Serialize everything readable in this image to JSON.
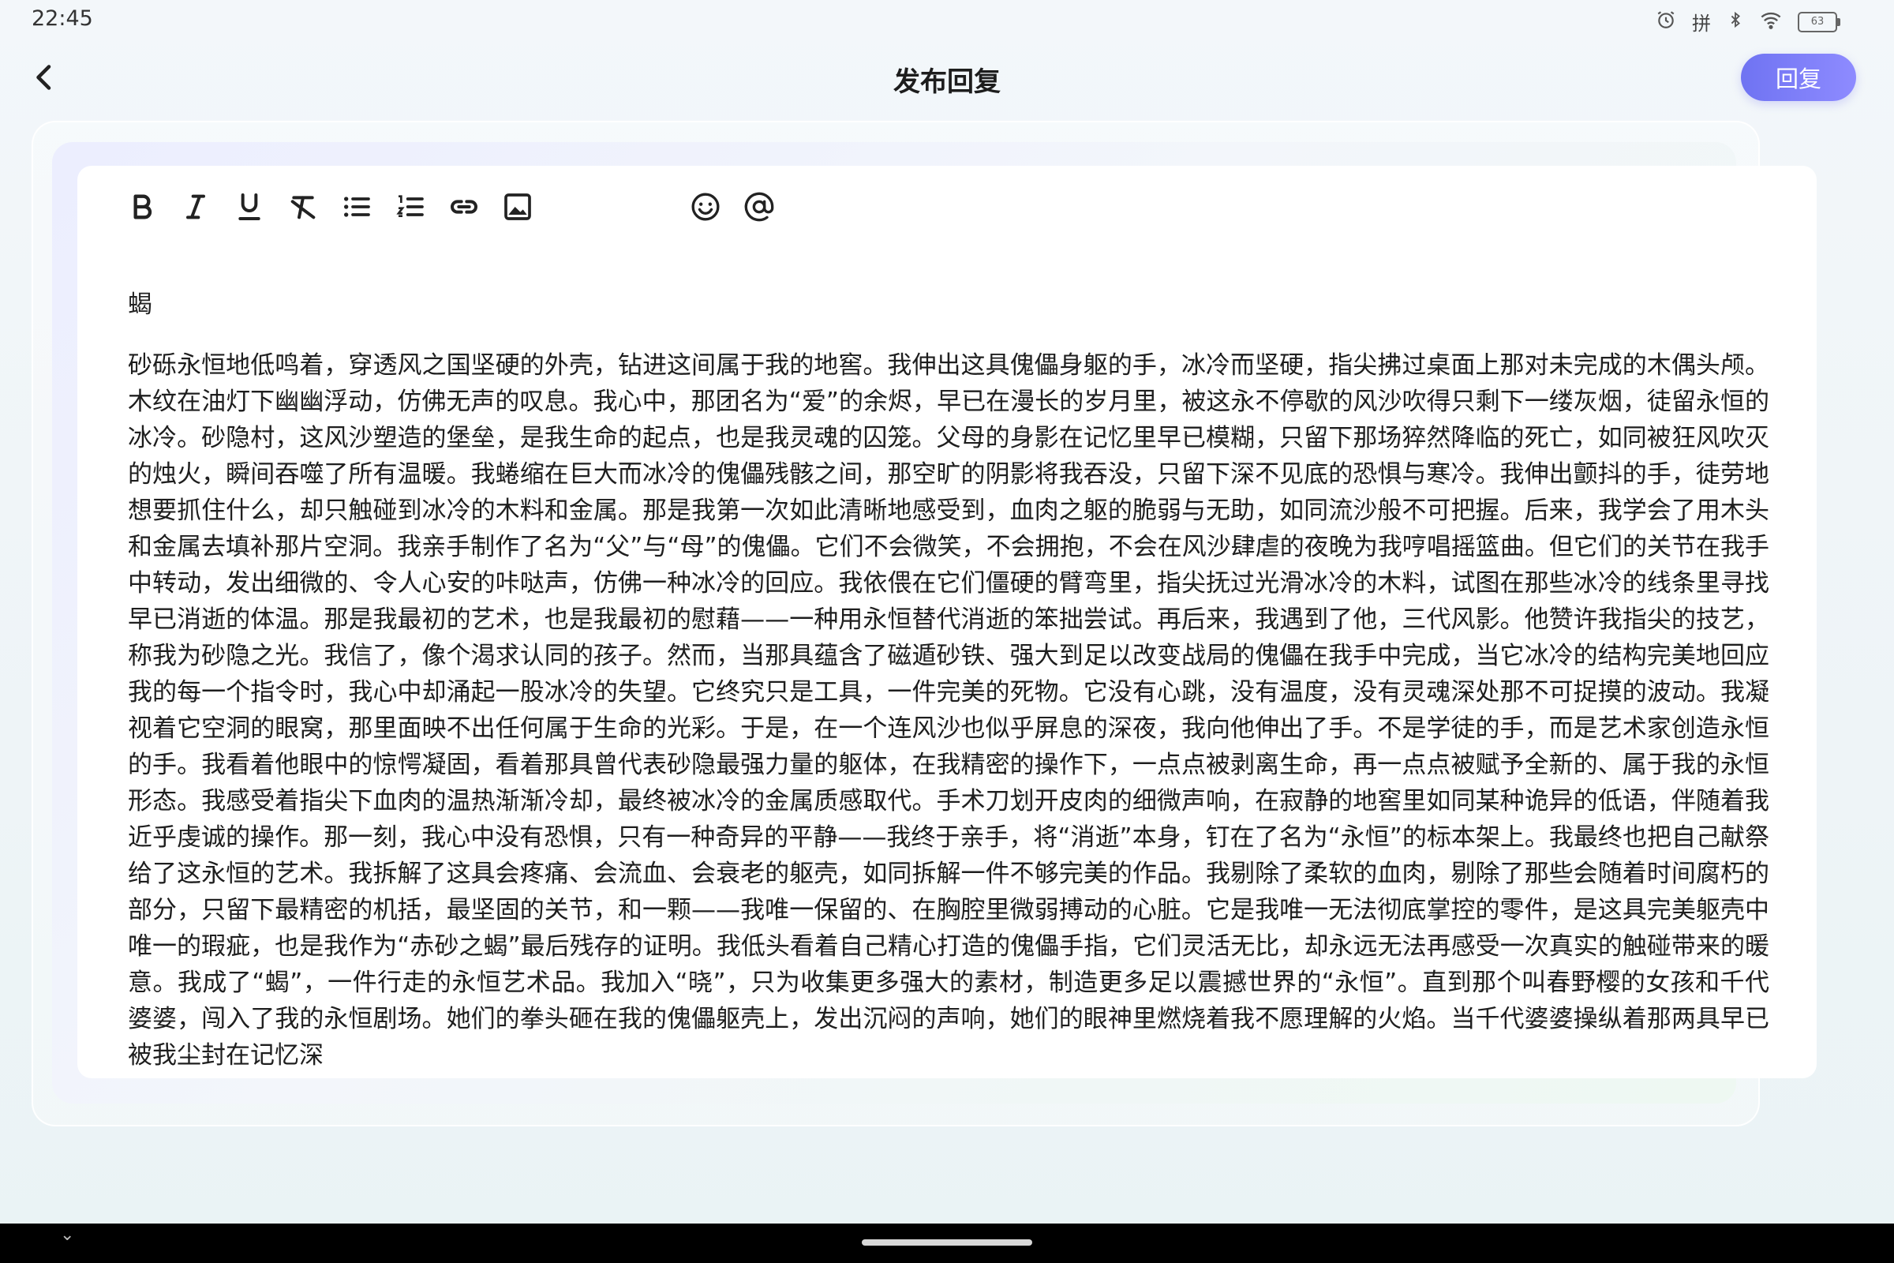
{
  "status": {
    "time": "22:45",
    "ime": "拼",
    "battery": "63"
  },
  "header": {
    "title": "发布回复",
    "reply_label": "回复"
  },
  "toolbar": {
    "tools": [
      "bold-icon",
      "italic-icon",
      "underline-icon",
      "clear-format-icon",
      "bullet-list-icon",
      "numbered-list-icon",
      "link-icon",
      "image-icon",
      "emoji-icon",
      "mention-icon"
    ]
  },
  "post": {
    "title": "蝎",
    "body": "砂砾永恒地低鸣着，穿透风之国坚硬的外壳，钻进这间属于我的地窖。我伸出这具傀儡身躯的手，冰冷而坚硬，指尖拂过桌面上那对未完成的木偶头颅。木纹在油灯下幽幽浮动，仿佛无声的叹息。我心中，那团名为“爱”的余烬，早已在漫长的岁月里，被这永不停歇的风沙吹得只剩下一缕灰烟，徒留永恒的冰冷。砂隐村，这风沙塑造的堡垒，是我生命的起点，也是我灵魂的囚笼。父母的身影在记忆里早已模糊，只留下那场猝然降临的死亡，如同被狂风吹灭的烛火，瞬间吞噬了所有温暖。我蜷缩在巨大而冰冷的傀儡残骸之间，那空旷的阴影将我吞没，只留下深不见底的恐惧与寒冷。我伸出颤抖的手，徒劳地想要抓住什么，却只触碰到冰冷的木料和金属。那是我第一次如此清晰地感受到，血肉之躯的脆弱与无助，如同流沙般不可把握。后来，我学会了用木头和金属去填补那片空洞。我亲手制作了名为“父”与“母”的傀儡。它们不会微笑，不会拥抱，不会在风沙肆虐的夜晚为我哼唱摇篮曲。但它们的关节在我手中转动，发出细微的、令人心安的咔哒声，仿佛一种冰冷的回应。我依偎在它们僵硬的臂弯里，指尖抚过光滑冰冷的木料，试图在那些冰冷的线条里寻找早已消逝的体温。那是我最初的艺术，也是我最初的慰藉——一种用永恒替代消逝的笨拙尝试。再后来，我遇到了他，三代风影。他赞许我指尖的技艺，称我为砂隐之光。我信了，像个渴求认同的孩子。然而，当那具蕴含了磁遁砂铁、强大到足以改变战局的傀儡在我手中完成，当它冰冷的结构完美地回应我的每一个指令时，我心中却涌起一股冰冷的失望。它终究只是工具，一件完美的死物。它没有心跳，没有温度，没有灵魂深处那不可捉摸的波动。我凝视着它空洞的眼窝，那里面映不出任何属于生命的光彩。于是，在一个连风沙也似乎屏息的深夜，我向他伸出了手。不是学徒的手，而是艺术家创造永恒的手。我看着他眼中的惊愕凝固，看着那具曾代表砂隐最强力量的躯体，在我精密的操作下，一点点被剥离生命，再一点点被赋予全新的、属于我的永恒形态。我感受着指尖下血肉的温热渐渐冷却，最终被冰冷的金属质感取代。手术刀划开皮肉的细微声响，在寂静的地窖里如同某种诡异的低语，伴随着我近乎虔诚的操作。那一刻，我心中没有恐惧，只有一种奇异的平静——我终于亲手，将“消逝”本身，钉在了名为“永恒”的标本架上。我最终也把自己献祭给了这永恒的艺术。我拆解了这具会疼痛、会流血、会衰老的躯壳，如同拆解一件不够完美的作品。我剔除了柔软的血肉，剔除了那些会随着时间腐朽的部分，只留下最精密的机括，最坚固的关节，和一颗——我唯一保留的、在胸腔里微弱搏动的心脏。它是我唯一无法彻底掌控的零件，是这具完美躯壳中唯一的瑕疵，也是我作为“赤砂之蝎”最后残存的证明。我低头看着自己精心打造的傀儡手指，它们灵活无比，却永远无法再感受一次真实的触碰带来的暖意。我成了“蝎”，一件行走的永恒艺术品。我加入“晓”，只为收集更多强大的素材，制造更多足以震撼世界的“永恒”。直到那个叫春野樱的女孩和千代婆婆，闯入了我的永恒剧场。她们的拳头砸在我的傀儡躯壳上，发出沉闷的声响，她们的眼神里燃烧着我不愿理解的火焰。当千代婆婆操纵着那两具早已被我尘封在记忆深"
  },
  "colors": {
    "accent": "#7b7cf6",
    "icon": "#2a2a2a"
  }
}
